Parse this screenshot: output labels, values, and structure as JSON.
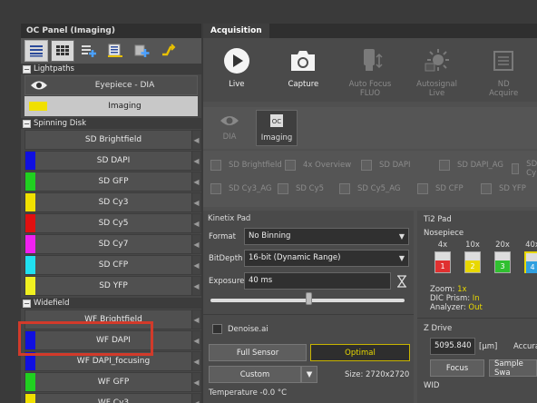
{
  "left_panel": {
    "title": "OC Panel (Imaging)",
    "toolbar": [
      "list-view-icon",
      "grid-view-icon",
      "add-list-icon",
      "edit-list-icon",
      "add-channel-icon",
      "flip-icon"
    ],
    "lightpaths": {
      "header": "Lightpaths",
      "items": [
        {
          "label": "Eyepiece - DIA",
          "icon": "eye-icon"
        },
        {
          "label": "Imaging",
          "color": "#f0e000"
        }
      ]
    },
    "spinning_disk": {
      "header": "Spinning Disk",
      "items": [
        {
          "label": "SD Brightfield",
          "color": "#505050"
        },
        {
          "label": "SD DAPI",
          "color": "#1010e0"
        },
        {
          "label": "SD GFP",
          "color": "#20d020"
        },
        {
          "label": "SD Cy3",
          "color": "#f0e000"
        },
        {
          "label": "SD Cy5",
          "color": "#e01010"
        },
        {
          "label": "SD Cy7",
          "color": "#f020f0"
        },
        {
          "label": "SD CFP",
          "color": "#20e0f0"
        },
        {
          "label": "SD YFP",
          "color": "#f0f020"
        }
      ]
    },
    "widefield": {
      "header": "Widefield",
      "items": [
        {
          "label": "WF Brightfield",
          "color": "#505050"
        },
        {
          "label": "WF DAPI",
          "color": "#1010e0"
        },
        {
          "label": "WF DAPI_focusing",
          "color": "#1010e0"
        },
        {
          "label": "WF GFP",
          "color": "#20d020"
        },
        {
          "label": "WF Cy3",
          "color": "#f0e000"
        }
      ]
    }
  },
  "acquisition": {
    "tab": "Acquisition",
    "tools": [
      {
        "label": "Live",
        "icon": "play-icon",
        "enabled": true
      },
      {
        "label": "Capture",
        "icon": "camera-icon",
        "enabled": true
      },
      {
        "label": "Auto Focus\nFLUO",
        "icon": "autofocus-icon",
        "enabled": false
      },
      {
        "label": "Autosignal\nLive",
        "icon": "autosignal-icon",
        "enabled": false
      },
      {
        "label": "ND\nAcquire",
        "icon": "nd-acquire-icon",
        "enabled": false
      }
    ],
    "modes": [
      {
        "label": "DIA",
        "icon": "eye-icon",
        "active": false
      },
      {
        "label": "Imaging",
        "icon": "oc-icon",
        "active": true
      }
    ],
    "presets_row1": [
      "SD Brightfield",
      "4x Overview",
      "SD DAPI",
      "SD DAPI_AG",
      "SD Cy"
    ],
    "presets_row2": [
      "SD Cy3_AG",
      "SD Cy5",
      "SD Cy5_AG",
      "SD CFP",
      "SD YFP"
    ]
  },
  "kinetix": {
    "title": "Kinetix Pad",
    "format_label": "Format",
    "format_value": "No Binning",
    "bitdepth_label": "BitDepth",
    "bitdepth_value": "16-bit (Dynamic Range)",
    "exposure_label": "Exposure",
    "exposure_value": "40 ms",
    "denoise_label": "Denoise.ai",
    "full_sensor": "Full Sensor",
    "optimal": "Optimal",
    "custom": "Custom",
    "size": "Size: 2720x2720",
    "temperature": "Temperature -0.0 °C"
  },
  "ti2": {
    "title": "Ti2 Pad",
    "nosepiece_label": "Nosepiece",
    "objectives": [
      {
        "mag": "4x",
        "pos": "1",
        "color": "#e03030"
      },
      {
        "mag": "10x",
        "pos": "2",
        "color": "#e8d800"
      },
      {
        "mag": "20x",
        "pos": "3",
        "color": "#30c030"
      },
      {
        "mag": "40x",
        "pos": "4",
        "color": "#30a0e0"
      }
    ],
    "zoom_label": "Zoom:",
    "zoom_value": "1x",
    "dic_label": "DIC Prism:",
    "dic_value": "In",
    "analyzer_label": "Analyzer:",
    "analyzer_value": "Out",
    "zdrive_label": "Z Drive",
    "z_value": "5095.840",
    "z_unit": "[µm]",
    "accuracy_label": "Accura",
    "focus_button": "Focus",
    "sample_button": "Sample Swa",
    "wid_label": "WID"
  },
  "colors": {
    "highlight": "#d23a2a",
    "optimal_accent": "#e8d800"
  }
}
